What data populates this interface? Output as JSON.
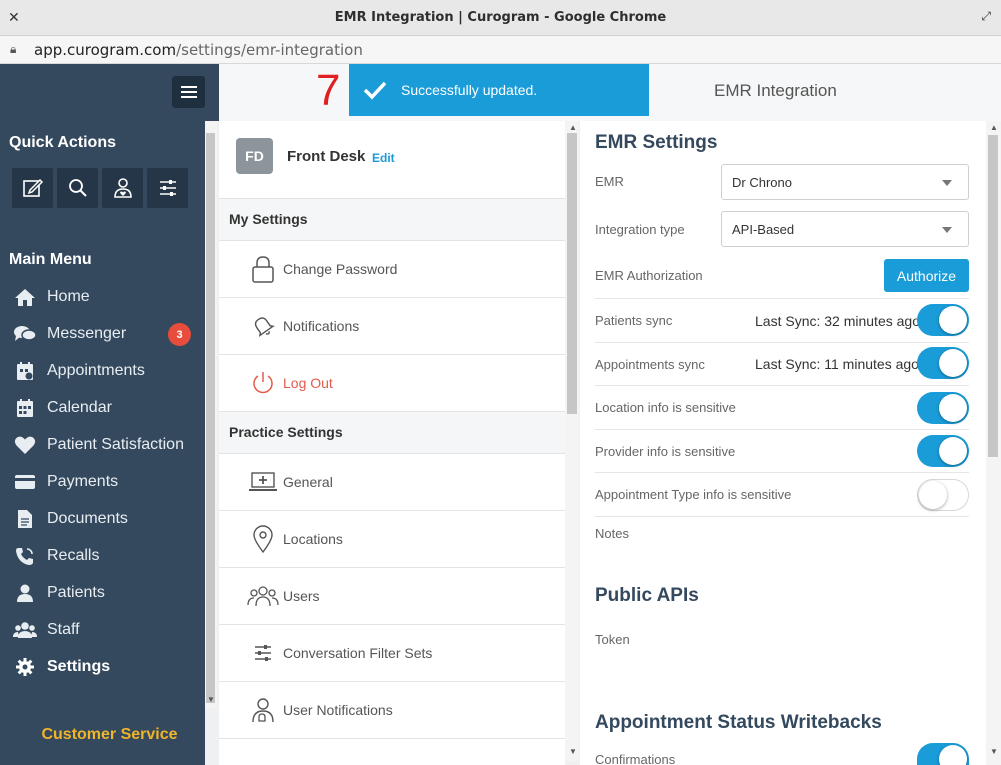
{
  "browser": {
    "window_title": "EMR Integration | Curogram - Google Chrome",
    "url_host": "app.curogram.com",
    "url_path": "/settings/emr-integration"
  },
  "sidebar": {
    "quick_actions_title": "Quick Actions",
    "quick_actions": [
      "compose-icon",
      "search-icon",
      "patient-heart-icon",
      "sliders-icon"
    ],
    "main_menu_title": "Main Menu",
    "items": [
      {
        "label": "Home",
        "icon": "home-icon"
      },
      {
        "label": "Messenger",
        "icon": "chat-icon",
        "badge": "3"
      },
      {
        "label": "Appointments",
        "icon": "appointments-icon"
      },
      {
        "label": "Calendar",
        "icon": "calendar-icon"
      },
      {
        "label": "Patient Satisfaction",
        "icon": "heart-icon"
      },
      {
        "label": "Payments",
        "icon": "credit-card-icon"
      },
      {
        "label": "Documents",
        "icon": "document-icon"
      },
      {
        "label": "Recalls",
        "icon": "phone-icon"
      },
      {
        "label": "Patients",
        "icon": "user-icon"
      },
      {
        "label": "Staff",
        "icon": "users-icon"
      },
      {
        "label": "Settings",
        "icon": "gear-icon",
        "active": true
      }
    ],
    "customer_service": "Customer Service"
  },
  "header": {
    "step_number": "7",
    "toast": "Successfully updated.",
    "title": "EMR Integration"
  },
  "settings_nav": {
    "profile": {
      "initials": "FD",
      "name": "Front Desk",
      "edit": "Edit"
    },
    "my_settings_title": "My Settings",
    "my_settings": [
      {
        "label": "Change Password",
        "icon": "lock-icon"
      },
      {
        "label": "Notifications",
        "icon": "bell-icon"
      },
      {
        "label": "Log Out",
        "icon": "power-icon"
      }
    ],
    "practice_settings_title": "Practice Settings",
    "practice_settings": [
      {
        "label": "General",
        "icon": "laptop-icon"
      },
      {
        "label": "Locations",
        "icon": "map-pin-icon"
      },
      {
        "label": "Users",
        "icon": "users-icon"
      },
      {
        "label": "Conversation Filter Sets",
        "icon": "sliders-icon"
      },
      {
        "label": "User Notifications",
        "icon": "user-bell-icon"
      }
    ]
  },
  "emr": {
    "title": "EMR Settings",
    "emr_label": "EMR",
    "emr_value": "Dr Chrono",
    "integration_label": "Integration type",
    "integration_value": "API-Based",
    "auth_label": "EMR Authorization",
    "auth_button": "Authorize",
    "patients_sync_label": "Patients sync",
    "patients_sync_status": "Last Sync: 32 minutes ago",
    "appointments_sync_label": "Appointments sync",
    "appointments_sync_status": "Last Sync: 11 minutes ago",
    "location_sensitive_label": "Location info is sensitive",
    "provider_sensitive_label": "Provider info is sensitive",
    "appt_type_sensitive_label": "Appointment Type info is sensitive",
    "notes_label": "Notes",
    "toggles": {
      "patients_sync": true,
      "appointments_sync": true,
      "location_sensitive": true,
      "provider_sensitive": true,
      "appt_type_sensitive": false,
      "confirmations": true
    }
  },
  "public_apis": {
    "title": "Public APIs",
    "token_label": "Token"
  },
  "writebacks": {
    "title": "Appointment Status Writebacks",
    "confirmations_label": "Confirmations"
  },
  "colors": {
    "sidebar": "#34495e",
    "accent": "#1a9cd8",
    "badge": "#e74c3c",
    "customer_service": "#f0b429",
    "step": "#e02020"
  }
}
